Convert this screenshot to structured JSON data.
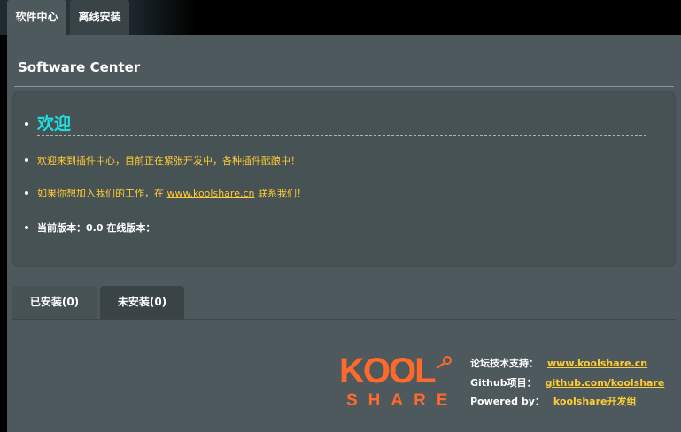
{
  "top_tabs": [
    {
      "label": "软件中心"
    },
    {
      "label": "离线安装"
    }
  ],
  "page_title": "Software Center",
  "info": {
    "welcome": "欢迎",
    "line1": "欢迎来到插件中心，目前正在紧张开发中，各种插件酝酿中！",
    "line2_prefix": "如果你想加入我们的工作，在 ",
    "line2_link": "www.koolshare.cn",
    "line2_suffix": " 联系我们！",
    "version_line": "当前版本：0.0 在线版本："
  },
  "plugin_tabs": [
    {
      "label": "已安装(0)"
    },
    {
      "label": "未安装(0)"
    }
  ],
  "logo": {
    "top": "KOOL",
    "bottom": "SHARE",
    "color": "#ff6a2b"
  },
  "footer": {
    "forum_label": "论坛技术支持：",
    "forum_link": "www.koolshare.cn",
    "github_label": "Github项目：",
    "github_link": "github.com/koolshare",
    "powered_label": "Powered by：",
    "powered_value": "koolshare开发组"
  },
  "colors": {
    "accent_yellow": "#ffcc33",
    "welcome_cyan": "#1ee0e0",
    "panel_bg": "#4d595d"
  }
}
